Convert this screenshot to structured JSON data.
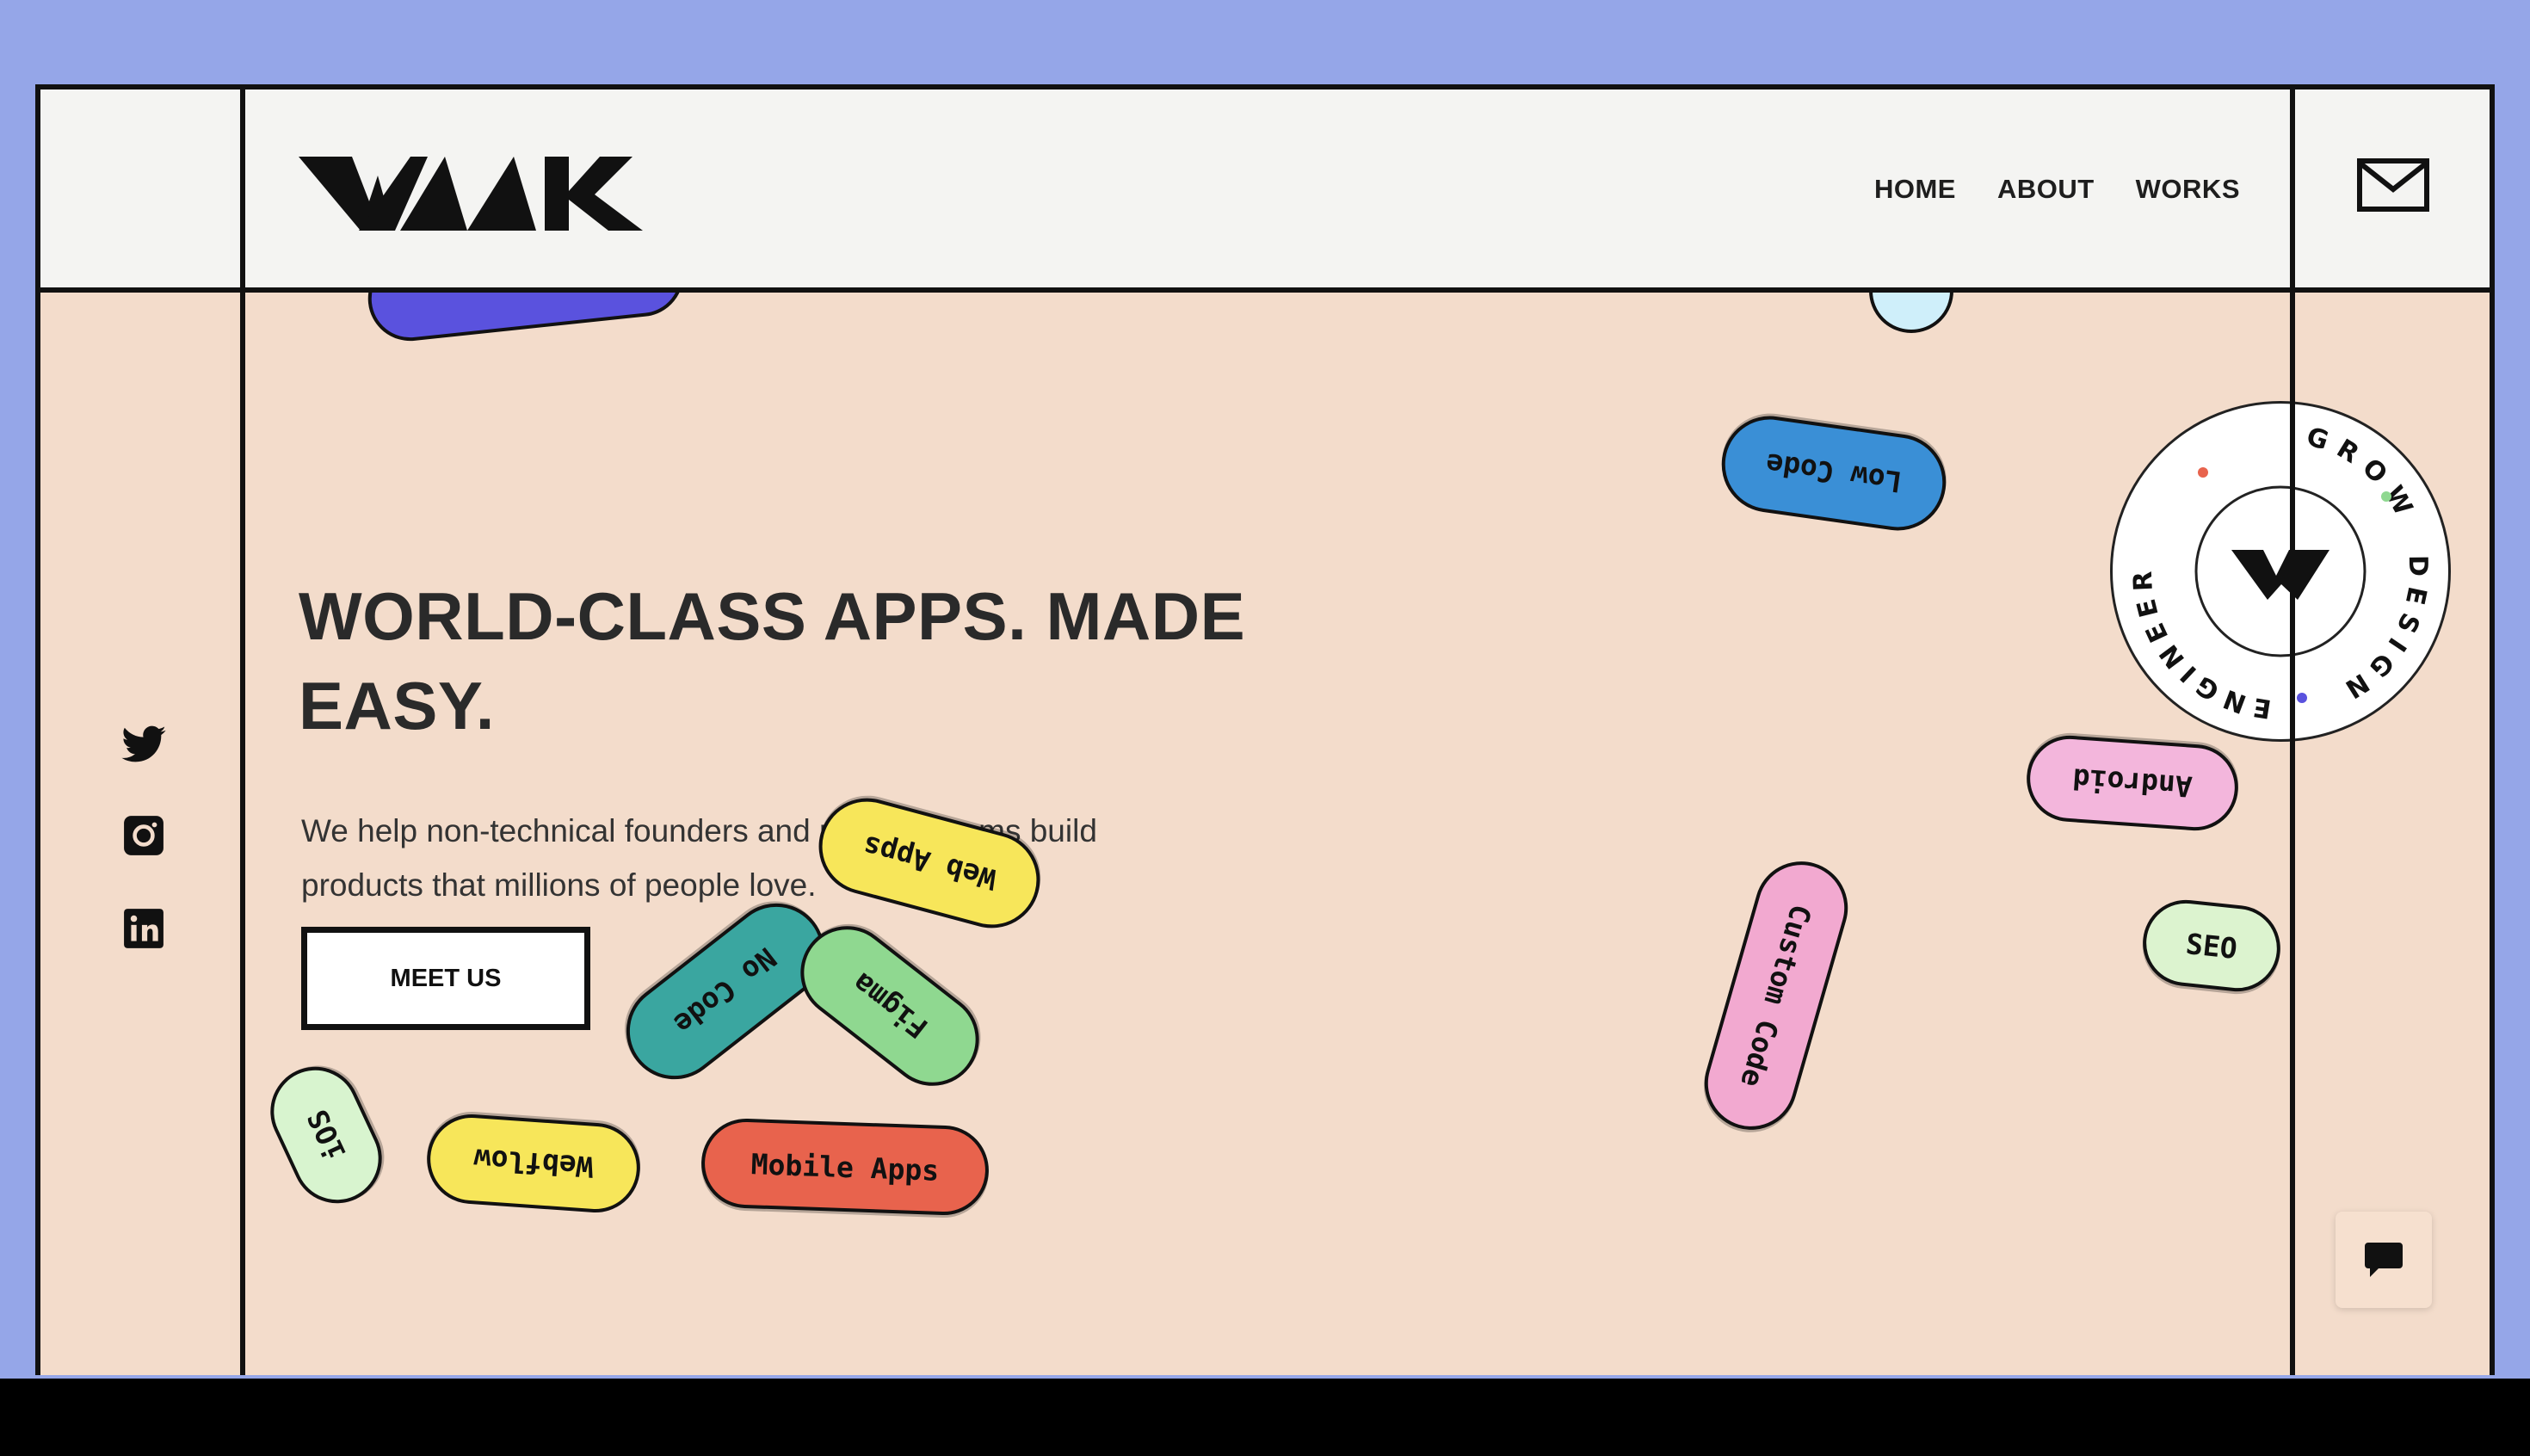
{
  "header": {
    "logo_alt": "WAAK",
    "nav": [
      {
        "label": "HOME"
      },
      {
        "label": "ABOUT"
      },
      {
        "label": "WORKS"
      }
    ]
  },
  "hero": {
    "headline_line1": "WORLD-CLASS APPS. MADE",
    "headline_line2": "EASY.",
    "subtext_line1": "We help non-technical founders and product teams build",
    "subtext_line2": "products that millions of people love.",
    "cta_label": "MEET US"
  },
  "social": [
    "twitter-icon",
    "instagram-icon",
    "linkedin-icon"
  ],
  "tags": [
    {
      "label": "Low Code",
      "color": "#3a8fd6"
    },
    {
      "label": "Android",
      "color": "#f3b6dc"
    },
    {
      "label": "Custom Code",
      "color": "#f2a9d0"
    },
    {
      "label": "SEO",
      "color": "#dcf3cf"
    },
    {
      "label": "Web Apps",
      "color": "#f7e65a"
    },
    {
      "label": "No Code",
      "color": "#3aa6a0"
    },
    {
      "label": "Figma",
      "color": "#8fd890"
    },
    {
      "label": "iOS",
      "color": "#d8f4cf"
    },
    {
      "label": "Webflow",
      "color": "#f7e65a"
    },
    {
      "label": "Mobile Apps",
      "color": "#e8634d"
    }
  ],
  "badge": {
    "words": [
      "GROW",
      "DESIGN",
      "ENGINEER"
    ]
  },
  "colors": {
    "background": "#95a6e8",
    "page": "#f3dccb",
    "header": "#f4f4f2",
    "ink": "#111111"
  }
}
